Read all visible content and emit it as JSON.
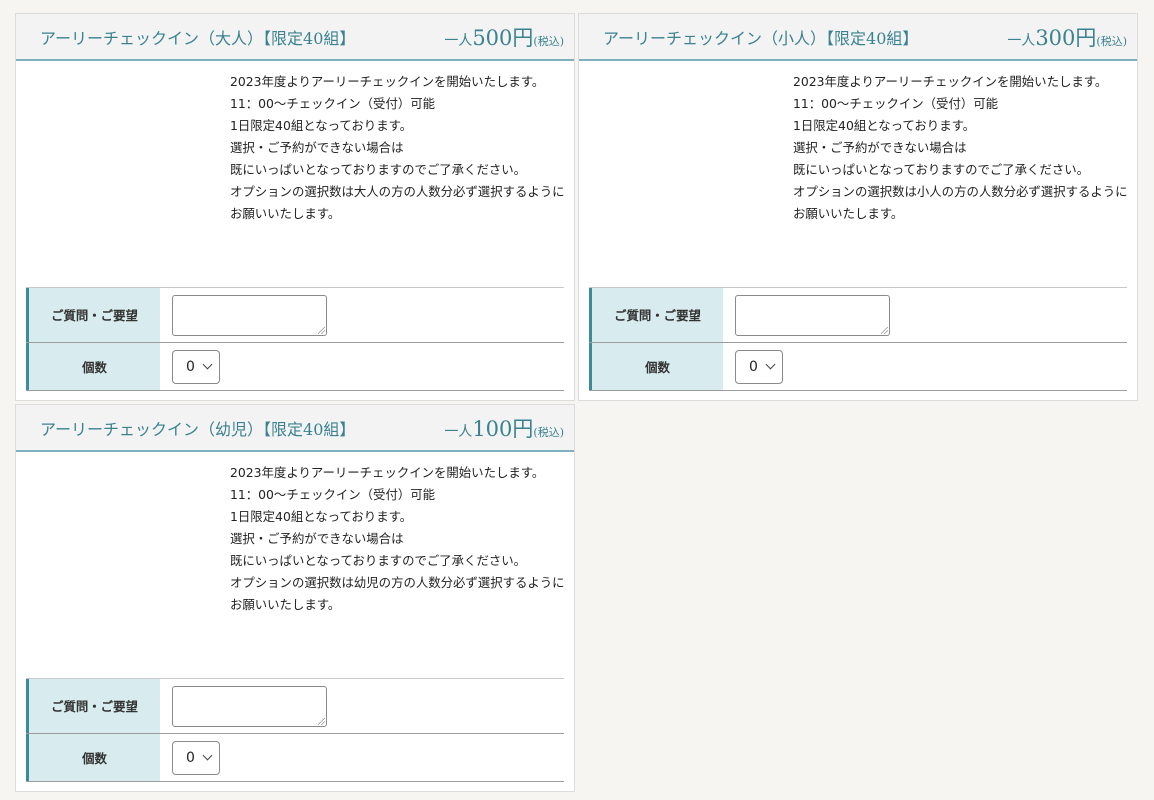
{
  "cards": [
    {
      "title": "アーリーチェックイン（大人）【限定40組】",
      "price_prefix": "一人",
      "price_amount": "500円",
      "price_tax": "(税込)",
      "description": [
        "2023年度よりアーリーチェックインを開始いたします。",
        "11：00〜チェックイン（受付）可能",
        "",
        "1日限定40組となっております。",
        "選択・ご予約ができない場合は",
        "既にいっぱいとなっておりますのでご了承ください。",
        "オプションの選択数は大人の方の人数分必ず選択するように",
        "お願いいたします。"
      ],
      "question_label": "ご質問・ご要望",
      "question_value": "",
      "qty_label": "個数",
      "qty_value": "0"
    },
    {
      "title": "アーリーチェックイン（小人）【限定40組】",
      "price_prefix": "一人",
      "price_amount": "300円",
      "price_tax": "(税込)",
      "description": [
        "2023年度よりアーリーチェックインを開始いたします。",
        "11：00〜チェックイン（受付）可能",
        "",
        "1日限定40組となっております。",
        "選択・ご予約ができない場合は",
        "既にいっぱいとなっておりますのでご了承ください。",
        "オプションの選択数は小人の方の人数分必ず選択するように",
        "お願いいたします。"
      ],
      "question_label": "ご質問・ご要望",
      "question_value": "",
      "qty_label": "個数",
      "qty_value": "0"
    },
    {
      "title": "アーリーチェックイン（幼児）【限定40組】",
      "price_prefix": "一人",
      "price_amount": "100円",
      "price_tax": "(税込)",
      "description": [
        "2023年度よりアーリーチェックインを開始いたします。",
        "11：00〜チェックイン（受付）可能",
        "",
        "1日限定40組となっております。",
        "選択・ご予約ができない場合は",
        "既にいっぱいとなっておりますのでご了承ください。",
        "オプションの選択数は幼児の方の人数分必ず選択するように",
        "お願いいたします。"
      ],
      "question_label": "ご質問・ご要望",
      "question_value": "",
      "qty_label": "個数",
      "qty_value": "0"
    }
  ],
  "colors": {
    "accent": "#3a8290",
    "label_background": "#d8ebee",
    "header_background": "#f3f3f3",
    "page_background": "#f6f5f1"
  }
}
